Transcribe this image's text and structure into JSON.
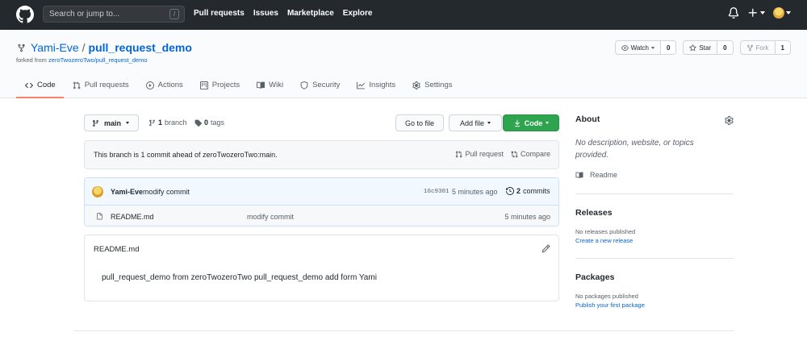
{
  "header": {
    "search_placeholder": "Search or jump to...",
    "search_shortcut": "/",
    "nav": [
      "Pull requests",
      "Issues",
      "Marketplace",
      "Explore"
    ]
  },
  "repo": {
    "owner": "Yami-Eve",
    "separator": "/",
    "name": "pull_request_demo",
    "forked_prefix": "forked from",
    "forked_from": "zeroTwozeroTwo/pull_request_demo",
    "watch_label": "Watch",
    "watch_count": "0",
    "star_label": "Star",
    "star_count": "0",
    "fork_label": "Fork",
    "fork_count": "1"
  },
  "tabs": [
    {
      "label": "Code",
      "icon": "code-icon",
      "active": true
    },
    {
      "label": "Pull requests",
      "icon": "pull-request-icon"
    },
    {
      "label": "Actions",
      "icon": "play-icon"
    },
    {
      "label": "Projects",
      "icon": "project-icon"
    },
    {
      "label": "Wiki",
      "icon": "book-icon"
    },
    {
      "label": "Security",
      "icon": "shield-icon"
    },
    {
      "label": "Insights",
      "icon": "graph-icon"
    },
    {
      "label": "Settings",
      "icon": "gear-icon"
    }
  ],
  "file_nav": {
    "branch": "main",
    "branch_count": "1",
    "branch_label": "branch",
    "tag_count": "0",
    "tag_label": "tags",
    "go_to_file": "Go to file",
    "add_file": "Add file",
    "code": "Code"
  },
  "ahead": {
    "text": "This branch is 1 commit ahead of zeroTwozeroTwo:main.",
    "pull_request": "Pull request",
    "compare": "Compare"
  },
  "commit": {
    "author": "Yami-Eve",
    "message": "modify commit",
    "sha": "16c9301",
    "time": "5 minutes ago",
    "count": "2",
    "count_label": "commits"
  },
  "files": [
    {
      "name": "README.md",
      "message": "modify commit",
      "time": "5 minutes ago"
    }
  ],
  "readme": {
    "title": "README.md",
    "body": "pull_request_demo from zeroTwozeroTwo pull_request_demo add form Yami"
  },
  "sidebar": {
    "about_title": "About",
    "about_desc": "No description, website, or topics provided.",
    "readme_label": "Readme",
    "releases_title": "Releases",
    "releases_none": "No releases published",
    "releases_link": "Create a new release",
    "packages_title": "Packages",
    "packages_none": "No packages published",
    "packages_link": "Publish your first package"
  },
  "colors": {
    "header_bg": "#24292e",
    "link": "#0366d6",
    "primary_button": "#2ea44f",
    "active_tab_underline": "#f9826c"
  }
}
